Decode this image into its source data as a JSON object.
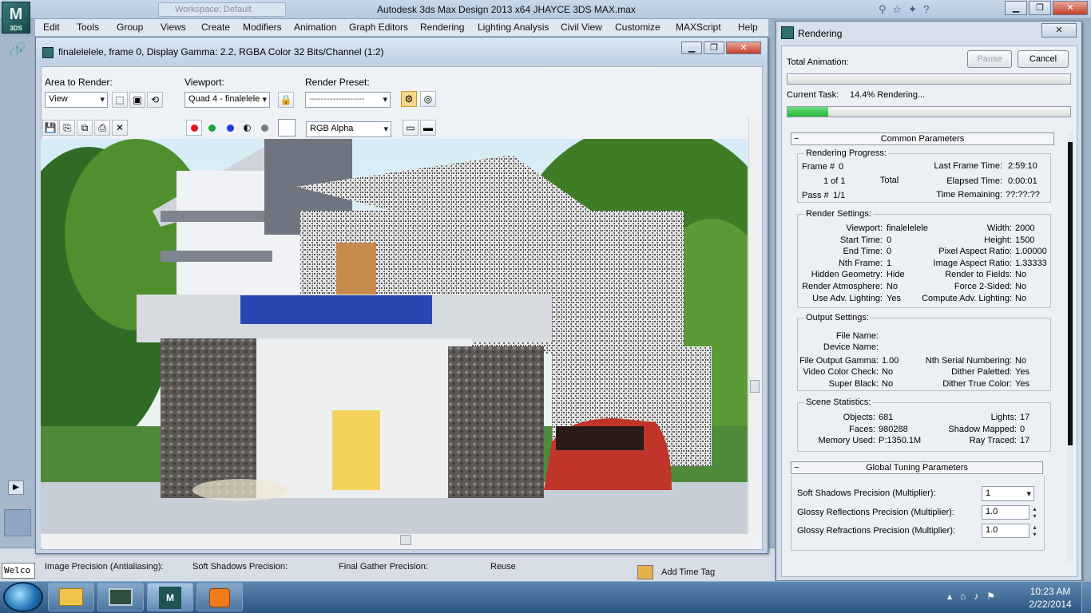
{
  "app": {
    "logo_text": "3DS",
    "workspace": "Workspace: Default",
    "title": "Autodesk 3ds Max Design 2013 x64     JHAYCE 3DS MAX.max"
  },
  "menu": [
    "Edit",
    "Tools",
    "Group",
    "Views",
    "Create",
    "Modifiers",
    "Animation",
    "Graph Editors",
    "Rendering",
    "Lighting Analysis",
    "Civil View",
    "Customize",
    "MAXScript",
    "Help"
  ],
  "render_frame": {
    "title": "finalelelele, frame 0, Display Gamma: 2.2, RGBA Color 32 Bits/Channel (1:2)",
    "area_label": "Area to Render:",
    "area_value": "View",
    "viewport_label": "Viewport:",
    "viewport_value": "Quad 4 - finalelele",
    "preset_label": "Render Preset:",
    "preset_value": "-------------------",
    "channel_value": "RGB Alpha"
  },
  "rendering": {
    "title": "Rendering",
    "total_animation_label": "Total Animation:",
    "pause_label": "Pause",
    "cancel_label": "Cancel",
    "current_task_label": "Current Task:",
    "current_task_value": "14.4%  Rendering...",
    "progress_fraction": 0.144,
    "common_header": "Common Parameters",
    "progress": {
      "group": "Rendering Progress:",
      "frame_label": "Frame #",
      "frame_value": "0",
      "of_value": "1 of 1",
      "total_label": "Total",
      "pass_label": "Pass #",
      "pass_value": "1/1",
      "last_frame_label": "Last Frame Time:",
      "last_frame_value": "2:59:10",
      "elapsed_label": "Elapsed Time:",
      "elapsed_value": "0:00:01",
      "remaining_label": "Time Remaining:",
      "remaining_value": "??:??:??"
    },
    "settings": {
      "group": "Render Settings:",
      "left": [
        {
          "label": "Viewport:",
          "value": "finalelelele"
        },
        {
          "label": "Start Time:",
          "value": "0"
        },
        {
          "label": "End Time:",
          "value": "0"
        },
        {
          "label": "Nth Frame:",
          "value": "1"
        },
        {
          "label": "Hidden Geometry:",
          "value": "Hide"
        },
        {
          "label": "Render Atmosphere:",
          "value": "No"
        },
        {
          "label": "Use Adv. Lighting:",
          "value": "Yes"
        }
      ],
      "right": [
        {
          "label": "Width:",
          "value": "2000"
        },
        {
          "label": "Height:",
          "value": "1500"
        },
        {
          "label": "Pixel Aspect Ratio:",
          "value": "1.00000"
        },
        {
          "label": "Image Aspect Ratio:",
          "value": "1.33333"
        },
        {
          "label": "Render to Fields:",
          "value": "No"
        },
        {
          "label": "Force 2-Sided:",
          "value": "No"
        },
        {
          "label": "Compute Adv. Lighting:",
          "value": "No"
        }
      ]
    },
    "output": {
      "group": "Output Settings:",
      "file_name_label": "File Name:",
      "device_name_label": "Device Name:",
      "left": [
        {
          "label": "File Output Gamma:",
          "value": "1.00"
        },
        {
          "label": "Video Color Check:",
          "value": "No"
        },
        {
          "label": "Super Black:",
          "value": "No"
        }
      ],
      "right": [
        {
          "label": "Nth Serial Numbering:",
          "value": "No"
        },
        {
          "label": "Dither Paletted:",
          "value": "Yes"
        },
        {
          "label": "Dither True Color:",
          "value": "Yes"
        }
      ]
    },
    "scene": {
      "group": "Scene Statistics:",
      "left": [
        {
          "label": "Objects:",
          "value": "681"
        },
        {
          "label": "Faces:",
          "value": "980288"
        },
        {
          "label": "Memory Used:",
          "value": "P:1350.1M"
        }
      ],
      "right": [
        {
          "label": "Lights:",
          "value": "17"
        },
        {
          "label": "Shadow Mapped:",
          "value": "0"
        },
        {
          "label": "Ray Traced:",
          "value": "17"
        }
      ]
    },
    "global_header": "Global Tuning Parameters",
    "tuning": [
      {
        "label": "Soft Shadows Precision (Multiplier):",
        "value": "1"
      },
      {
        "label": "Glossy Reflections Precision (Multiplier):",
        "value": "1.0"
      },
      {
        "label": "Glossy Refractions Precision (Multiplier):",
        "value": "1.0"
      }
    ]
  },
  "bottom": {
    "welcome": "Welco",
    "image_precision": "Image Precision (Antialiasing):",
    "soft_shadows": "Soft Shadows Precision:",
    "final_gather": "Final Gather Precision:",
    "reuse": "Reuse",
    "add_time_tag": "Add Time Tag"
  },
  "taskbar": {
    "time": "10:23 AM",
    "date": "2/22/2014"
  },
  "colors": {
    "progress_green": "#22b33a",
    "render_red": "#e01b1b",
    "render_green": "#1aa33a",
    "render_blue": "#1d3fd1"
  },
  "icons": [
    "search-icon",
    "close-icon",
    "minimize-icon",
    "maximize-icon",
    "save-icon",
    "copy-icon",
    "clone-icon",
    "print-icon",
    "clear-icon",
    "lock-icon",
    "folder-icon",
    "speaker-icon",
    "network-icon",
    "flag-icon"
  ]
}
